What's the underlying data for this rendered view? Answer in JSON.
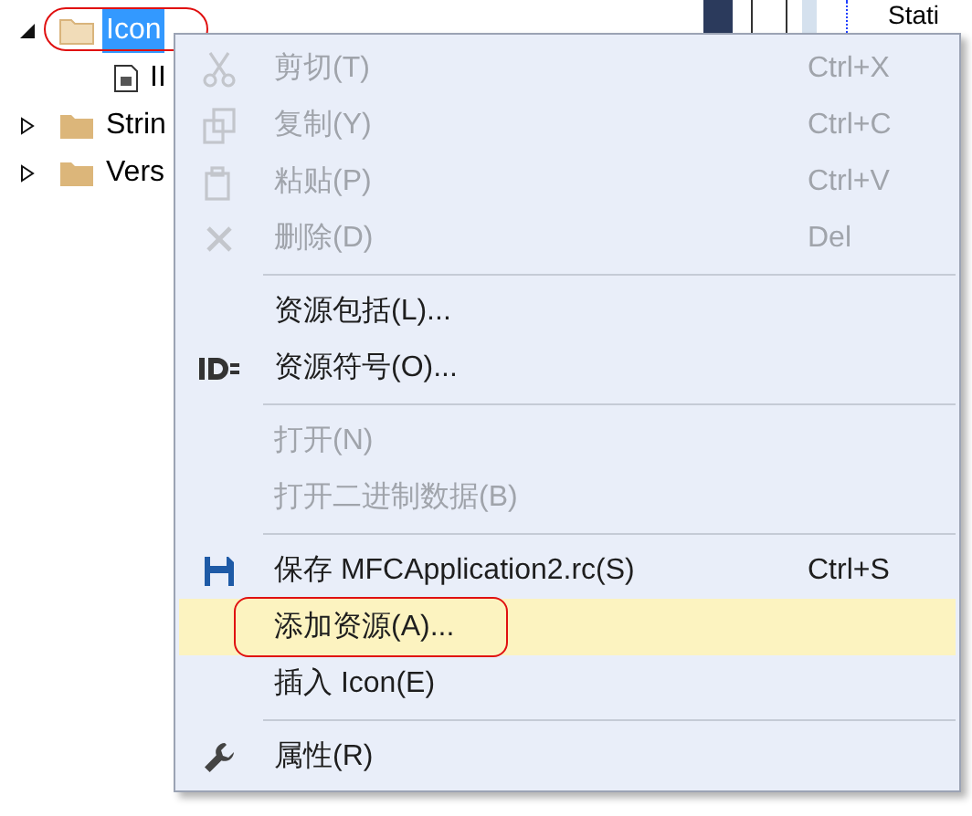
{
  "tree": [
    {
      "label": "Icon",
      "expanded": true,
      "selected": true,
      "children": [
        {
          "label": "II"
        }
      ]
    },
    {
      "label": "Strin",
      "expanded": false,
      "selected": false
    },
    {
      "label": "Vers",
      "expanded": false,
      "selected": false
    }
  ],
  "side_panel": {
    "label": "Stati"
  },
  "menu": {
    "items": [
      {
        "kind": "item",
        "label": "剪切(T)",
        "shortcut": "Ctrl+X",
        "disabled": true,
        "selected": false
      },
      {
        "kind": "item",
        "label": "复制(Y)",
        "shortcut": "Ctrl+C",
        "disabled": true,
        "selected": false
      },
      {
        "kind": "item",
        "label": "粘贴(P)",
        "shortcut": "Ctrl+V",
        "disabled": true,
        "selected": false
      },
      {
        "kind": "item",
        "label": "删除(D)",
        "shortcut": "Del",
        "disabled": true,
        "selected": false
      },
      {
        "kind": "separator"
      },
      {
        "kind": "item",
        "label": "资源包括(L)...",
        "disabled": false,
        "selected": false
      },
      {
        "kind": "item",
        "label": "资源符号(O)...",
        "disabled": false,
        "selected": false
      },
      {
        "kind": "separator"
      },
      {
        "kind": "item",
        "label": "打开(N)",
        "disabled": true,
        "selected": false
      },
      {
        "kind": "item",
        "label": "打开二进制数据(B)",
        "disabled": true,
        "selected": false
      },
      {
        "kind": "separator"
      },
      {
        "kind": "item",
        "label": "保存 MFCApplication2.rc(S)",
        "shortcut": "Ctrl+S",
        "disabled": false,
        "selected": false
      },
      {
        "kind": "item",
        "label": "添加资源(A)...",
        "disabled": false,
        "selected": true
      },
      {
        "kind": "item",
        "label": "插入 Icon(E)",
        "disabled": false,
        "selected": false
      },
      {
        "kind": "separator"
      },
      {
        "kind": "item",
        "label": "属性(R)",
        "disabled": false,
        "selected": false
      }
    ]
  }
}
